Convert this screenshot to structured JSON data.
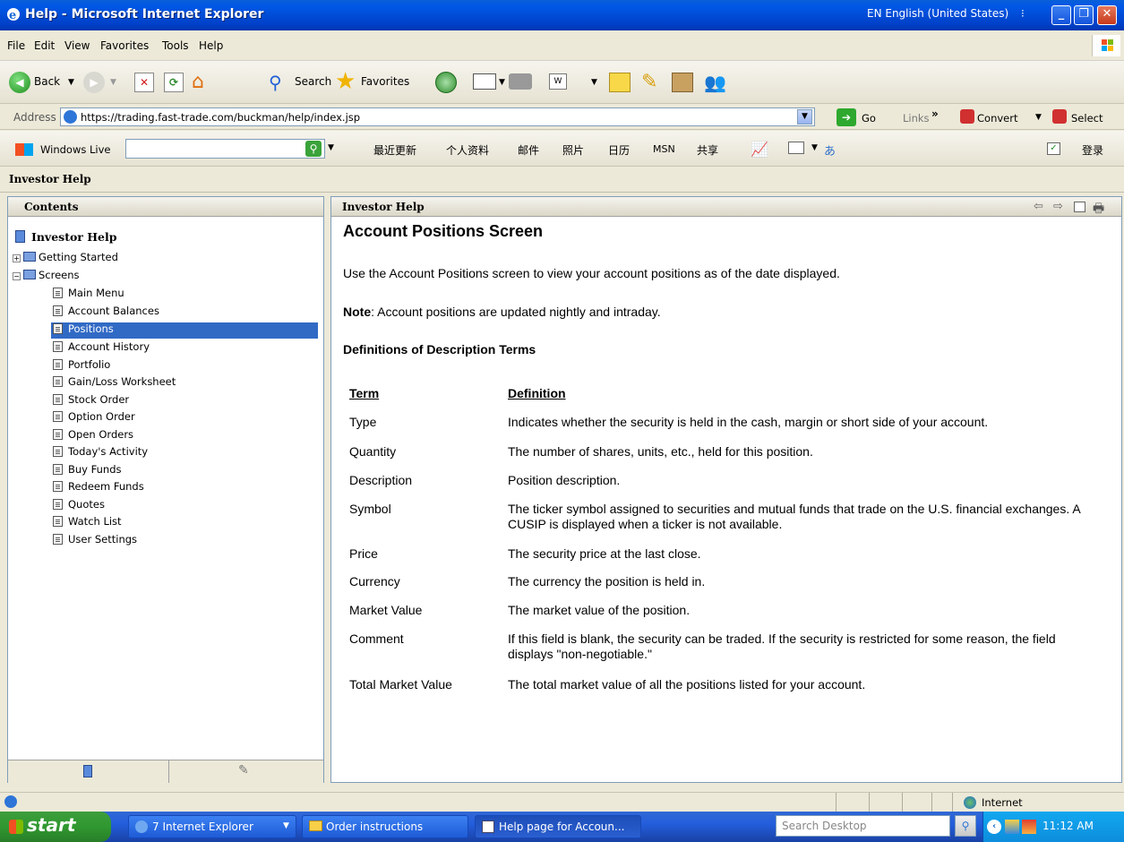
{
  "window": {
    "title": "Help - Microsoft Internet Explorer",
    "language_indicator": "EN English (United States)"
  },
  "menu": [
    "File",
    "Edit",
    "View",
    "Favorites",
    "Tools",
    "Help"
  ],
  "toolbar": {
    "back_label": "Back",
    "search_label": "Search",
    "favorites_label": "Favorites"
  },
  "address": {
    "label": "Address",
    "url": "https://trading.fast-trade.com/buckman/help/index.jsp",
    "go_label": "Go",
    "links_label": "Links",
    "convert_label": "Convert",
    "select_label": "Select"
  },
  "live": {
    "brand": "Windows Live",
    "links": [
      "最近更新",
      "个人资料",
      "邮件",
      "照片",
      "日历",
      "MSN",
      "共享"
    ],
    "signin_label": "登录"
  },
  "help_header": "Investor Help",
  "contents": {
    "header": "Contents",
    "root": "Investor Help",
    "books": [
      "Getting Started",
      "Screens"
    ],
    "pages": [
      "Main Menu",
      "Account Balances",
      "Positions",
      "Account History",
      "Portfolio",
      "Gain/Loss Worksheet",
      "Stock Order",
      "Option Order",
      "Open Orders",
      "Today's Activity",
      "Buy Funds",
      "Redeem Funds",
      "Quotes",
      "Watch List",
      "User Settings"
    ],
    "selected": "Positions"
  },
  "topic": {
    "header": "Investor Help",
    "title": "Account Positions Screen",
    "intro": "Use the Account Positions screen to view your account positions as of the date displayed.",
    "note_label": "Note",
    "note_text": ":  Account positions are updated nightly and intraday.",
    "section_title": "Definitions of Description Terms",
    "col_term": "Term",
    "col_definition": "Definition",
    "rows": [
      {
        "term": "Type",
        "definition": "Indicates whether the security is held in the cash, margin or short side of your account."
      },
      {
        "term": "Quantity",
        "definition": "The number of shares, units, etc., held for this position."
      },
      {
        "term": "Description",
        "definition": "Position description."
      },
      {
        "term": "Symbol",
        "definition": "The ticker symbol assigned to securities and mutual funds that trade on the U.S. financial exchanges.  A CUSIP is displayed when a ticker is not available."
      },
      {
        "term": "Price",
        "definition": "The security price at the last close."
      },
      {
        "term": "Currency",
        "definition": "The currency the position is held in."
      },
      {
        "term": "Market Value",
        "definition": "The market value of the position."
      },
      {
        "term": "Comment",
        "definition": "If this field is blank, the security can be traded.  If the security is restricted for some reason, the field displays \"non-negotiable.\""
      },
      {
        "term": "Total Market Value",
        "definition": "The total market value of all the positions listed for your account."
      }
    ]
  },
  "status": {
    "zone": "Internet"
  },
  "taskbar": {
    "start_label": "start",
    "tasks": [
      "7 Internet Explorer",
      "Order instructions",
      "Help page for Accoun..."
    ],
    "search_placeholder": "Search Desktop",
    "clock": "11:12 AM"
  },
  "colors": {
    "titlebar": "#0058E6",
    "selection": "#316AC5",
    "taskbar": "#245EDC",
    "start": "#309830"
  }
}
